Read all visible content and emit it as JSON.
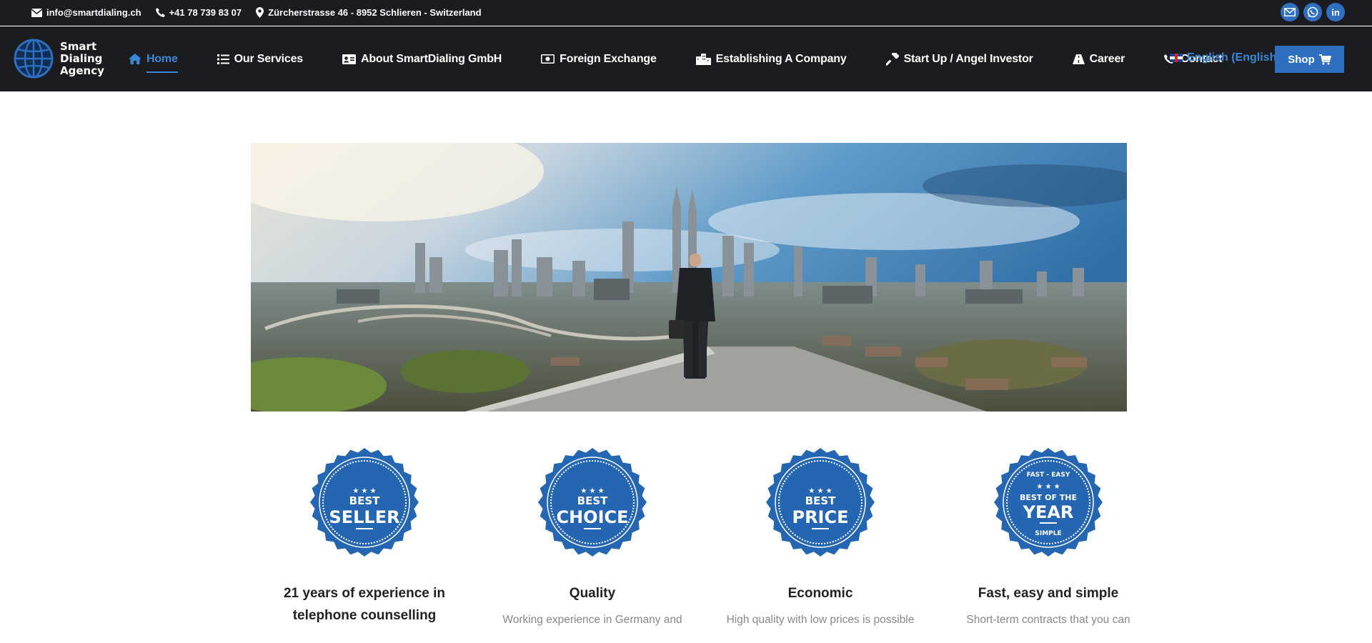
{
  "topbar": {
    "email": "info@smartdialing.ch",
    "phone": "+41 78 739 83 07",
    "address": "Zürcherstrasse 46 - 8952 Schlieren - Switzerland",
    "socials": [
      "mail-icon",
      "whatsapp-icon",
      "linkedin-icon"
    ]
  },
  "brand": {
    "line1": "Smart",
    "line2": "Dialing",
    "line3": "Agency"
  },
  "nav": {
    "items": [
      {
        "label": "Home",
        "icon": "home-icon",
        "active": true
      },
      {
        "label": "Our Services",
        "icon": "list-icon"
      },
      {
        "label": "About SmartDialing GmbH",
        "icon": "id-card-icon"
      },
      {
        "label": "Foreign Exchange",
        "icon": "money-icon"
      },
      {
        "label": "Establishing A Company",
        "icon": "building-icon"
      },
      {
        "label": "Start Up / Angel Investor",
        "icon": "hammer-icon"
      },
      {
        "label": "Career",
        "icon": "road-icon"
      },
      {
        "label": "Contact",
        "icon": "phone-icon"
      }
    ],
    "language": "English (English)",
    "shop_label": "Shop"
  },
  "features": [
    {
      "badge_top": "BEST",
      "badge_main": "SELLER",
      "title_line1": "21 years of experience in",
      "title_line2": "telephone counselling",
      "text": ""
    },
    {
      "badge_top": "BEST",
      "badge_main": "CHOICE",
      "title_line1": "Quality",
      "title_line2": "",
      "text": "Working experience in Germany and"
    },
    {
      "badge_top": "BEST",
      "badge_main": "PRICE",
      "title_line1": "Economic",
      "title_line2": "",
      "text": "High quality with low prices is possible"
    },
    {
      "badge_top": "BEST OF THE",
      "badge_main": "YEAR",
      "badge_arc_top": "FAST - EASY",
      "badge_arc_bottom": "SIMPLE",
      "title_line1": "Fast, easy and simple",
      "title_line2": "",
      "text": "Short-term contracts that you can"
    }
  ],
  "colors": {
    "accent": "#2f6fc1",
    "nav_bg": "#1b1c20",
    "badge": "#2566b3"
  }
}
